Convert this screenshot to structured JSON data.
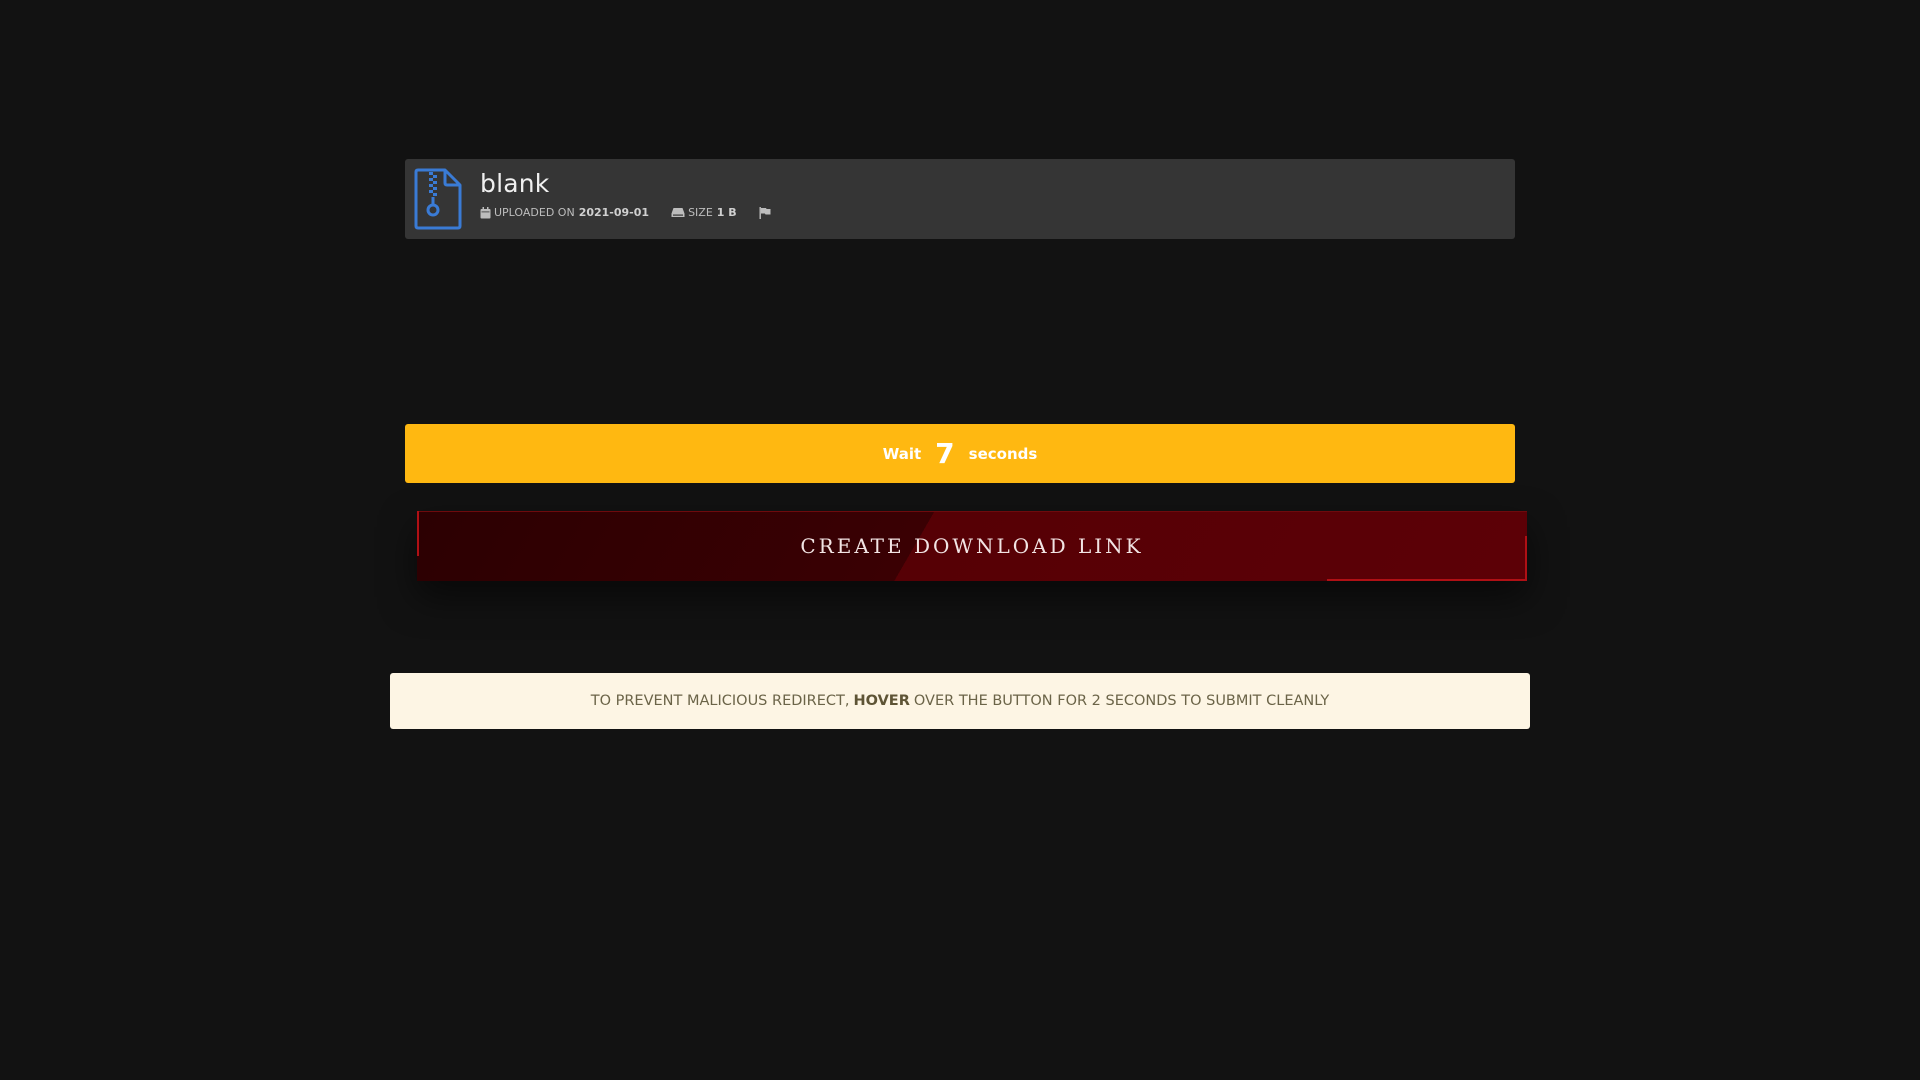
{
  "file": {
    "name": "blank",
    "icon": "zip-file-icon",
    "uploaded_label": "UPLOADED ON",
    "uploaded_date": "2021-09-01",
    "size_label": "SIZE",
    "size_value": "1 B",
    "report_icon": "flag-icon"
  },
  "wait": {
    "prefix": "Wait",
    "count": "7",
    "suffix": "seconds",
    "color": "#ffb811"
  },
  "download": {
    "button_label": "CREATE DOWNLOAD LINK",
    "color": "#560005"
  },
  "notice": {
    "text_before": "TO PREVENT MALICIOUS REDIRECT,",
    "text_bold": "HOVER",
    "text_after": "OVER THE BUTTON FOR 2 SECONDS TO SUBMIT CLEANLY"
  },
  "colors": {
    "background": "#121212",
    "card": "#353535",
    "icon_blue": "#3a7bd5"
  }
}
